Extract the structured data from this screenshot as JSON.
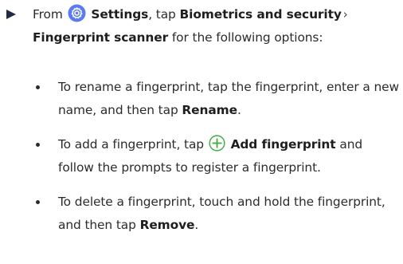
{
  "step": {
    "from": "From",
    "settings": "Settings",
    "tap": ", tap",
    "biometrics": "Biometrics and security",
    "scanner": "Fingerprint scanner",
    "for_options": "for the following options:"
  },
  "options": {
    "rename": {
      "text": "To rename a fingerprint, tap the fingerprint, enter a new name, and then tap",
      "action": "Rename",
      "end": "."
    },
    "add": {
      "text_before": "To add a fingerprint, tap",
      "action": "Add fingerprint",
      "text_after": "and follow the prompts to register a fingerprint."
    },
    "delete": {
      "text": "To delete a fingerprint, touch and hold the fingerprint, and then tap",
      "action": "Remove",
      "end": "."
    }
  },
  "icons": {
    "settings": "settings-gear-icon",
    "add": "plus-circle-icon",
    "step_marker": "triangle-bullet-icon"
  },
  "colors": {
    "settings_icon": "#5b7cf0",
    "add_icon": "#3fae3f",
    "step_marker": "#1f2a44"
  }
}
